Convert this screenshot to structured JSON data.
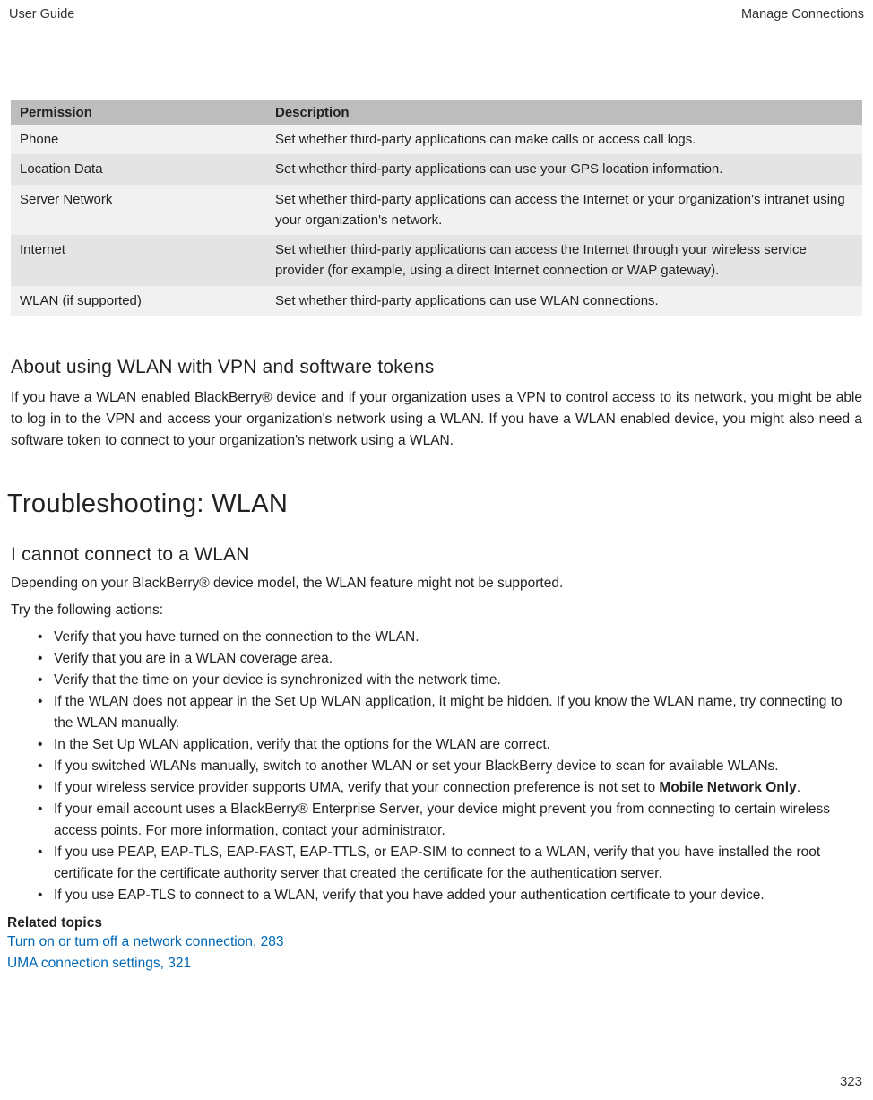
{
  "header": {
    "left": "User Guide",
    "right": "Manage Connections"
  },
  "table": {
    "head": {
      "c1": "Permission",
      "c2": "Description"
    },
    "rows": [
      {
        "c1": "Phone",
        "c2": "Set whether third-party applications can make calls or access call logs."
      },
      {
        "c1": "Location Data",
        "c2": "Set whether third-party applications can use your GPS location information."
      },
      {
        "c1": "Server Network",
        "c2": "Set whether third-party applications can access the Internet or your organization's intranet using your organization's network."
      },
      {
        "c1": "Internet",
        "c2": "Set whether third-party applications can access the Internet through your wireless service provider (for example, using a direct Internet connection or WAP gateway)."
      },
      {
        "c1": "WLAN (if supported)",
        "c2": "Set whether third-party applications can use WLAN connections."
      }
    ]
  },
  "s1": {
    "title": "About using WLAN with VPN and software tokens",
    "body": "If you have a WLAN enabled BlackBerry® device and if your organization uses a VPN to control access to its network, you might be able to log in to the VPN and access your organization's network using a WLAN. If you have a WLAN enabled device, you might also need a software token to connect to your organization's network using a WLAN."
  },
  "s2": {
    "title": "Troubleshooting: WLAN",
    "sub": "I cannot connect to a WLAN",
    "p1": "Depending on your BlackBerry® device model, the WLAN feature might not be supported.",
    "p2": "Try the following actions:",
    "items": [
      "Verify that you have turned on the connection to the WLAN.",
      "Verify that you are in a WLAN coverage area.",
      "Verify that the time on your device is synchronized with the network time.",
      "If the WLAN does not appear in the Set Up WLAN application, it might be hidden. If you know the WLAN name, try connecting to the WLAN manually.",
      "In the Set Up WLAN application, verify that the options for the WLAN are correct.",
      "If you switched WLANs manually, switch to another WLAN or set your BlackBerry device to scan for available WLANs.",
      "__BOLD__",
      "If your email account uses a BlackBerry® Enterprise Server, your device might prevent you from connecting to certain wireless access points. For more information, contact your administrator.",
      "If you use PEAP, EAP-TLS, EAP-FAST, EAP-TTLS, or EAP-SIM to connect to a WLAN, verify that you have installed the root certificate for the certificate authority server that created the certificate for the authentication server.",
      "If you use EAP-TLS to connect to a WLAN, verify that you have added your authentication certificate to your device."
    ],
    "bold_item": {
      "pre": "If your wireless service provider supports UMA, verify that your connection preference is not set to ",
      "bold": "Mobile Network Only",
      "post": "."
    }
  },
  "related": {
    "heading": "Related topics",
    "links": [
      "Turn on or turn off a network connection, 283",
      "UMA connection settings, 321"
    ]
  },
  "page_number": "323"
}
